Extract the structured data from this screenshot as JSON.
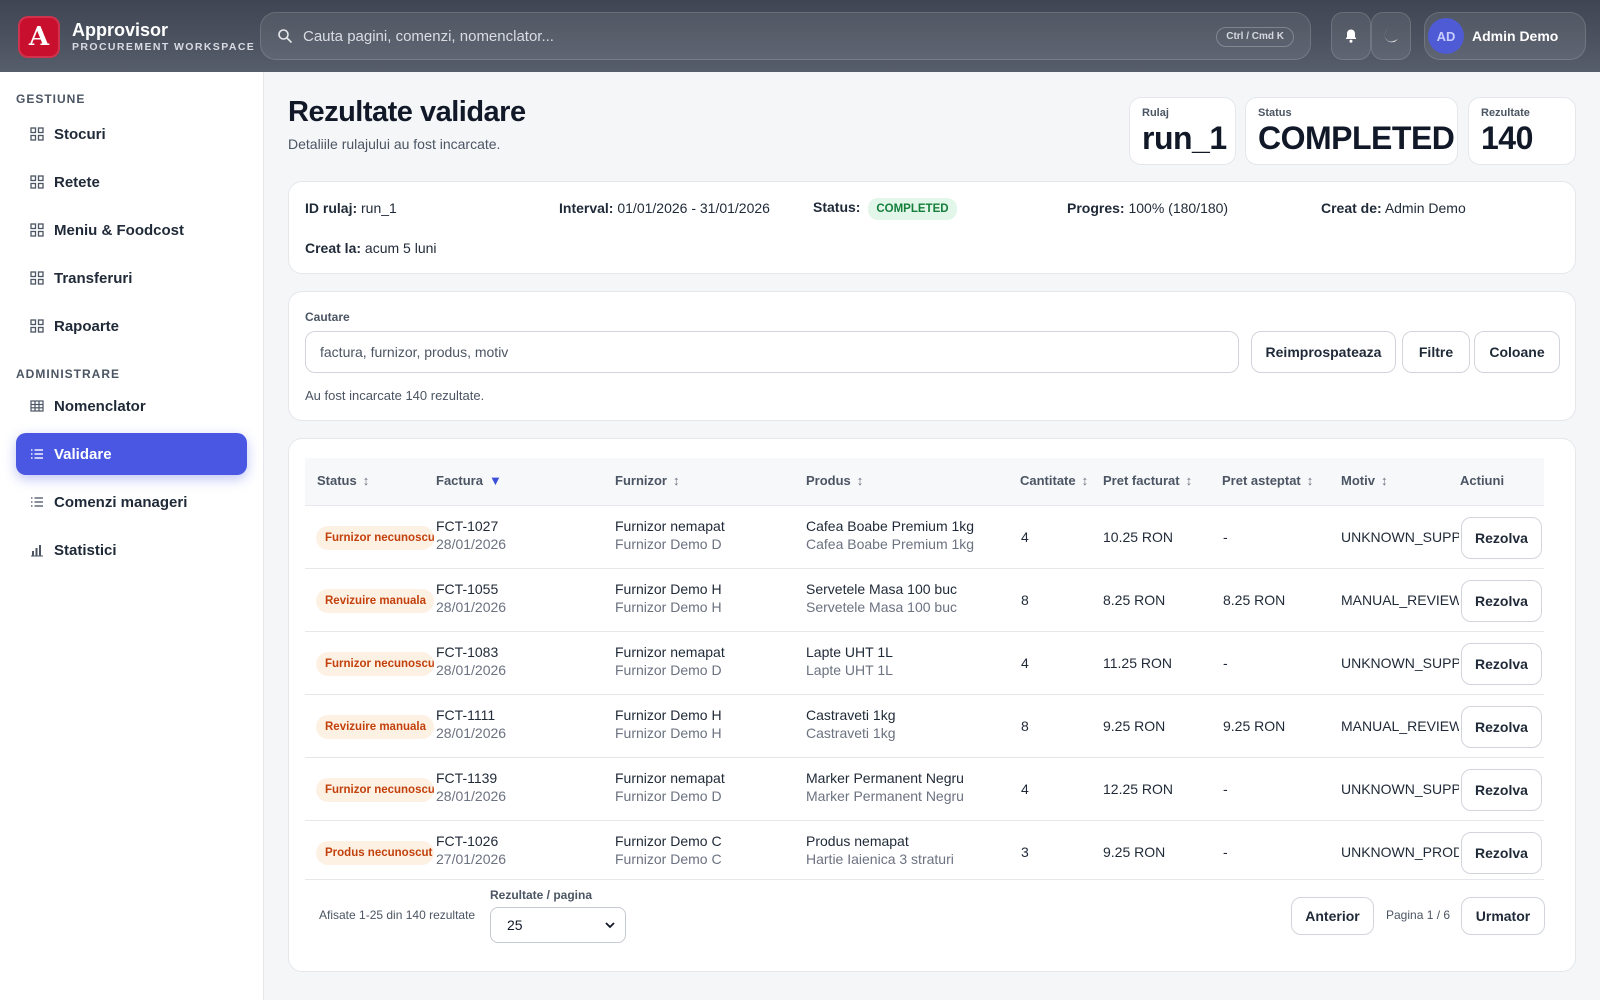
{
  "app": {
    "logo_letter": "A",
    "name": "Approvisor",
    "subtitle": "PROCUREMENT WORKSPACE",
    "search_placeholder": "Cauta pagini, comenzi, nomenclator...",
    "search_shortcut": "Ctrl / Cmd K",
    "user_initials": "AD",
    "user_name": "Admin Demo",
    "icons": {
      "search": "search-icon",
      "notifications": "bell-icon",
      "theme": "moon-icon"
    }
  },
  "sidebar": {
    "section_gestiune": "GESTIUNE",
    "gestiune": [
      {
        "label": "Stocuri",
        "icon": "grid-icon"
      },
      {
        "label": "Retete",
        "icon": "grid-icon"
      },
      {
        "label": "Meniu & Foodcost",
        "icon": "grid-icon"
      },
      {
        "label": "Transferuri",
        "icon": "grid-icon"
      },
      {
        "label": "Rapoarte",
        "icon": "grid-icon"
      }
    ],
    "section_administrare": "ADMINISTRARE",
    "administrare": [
      {
        "label": "Nomenclator",
        "icon": "table-icon"
      },
      {
        "label": "Validare",
        "icon": "list-icon",
        "active": true
      },
      {
        "label": "Comenzi manageri",
        "icon": "list-icon"
      },
      {
        "label": "Statistici",
        "icon": "bar-chart-icon"
      }
    ]
  },
  "header": {
    "title": "Rezultate validare",
    "subtitle": "Detaliile rulajului au fost incarcate.",
    "stats": [
      {
        "label": "Rulaj",
        "value": "run_1"
      },
      {
        "label": "Status",
        "value": "COMPLETED"
      },
      {
        "label": "Rezultate",
        "value": "140"
      }
    ]
  },
  "info": {
    "id_label": "ID rulaj:",
    "id_value": "run_1",
    "interval_label": "Interval:",
    "interval_value": "01/01/2026 - 31/01/2026",
    "status_label": "Status:",
    "status_value": "COMPLETED",
    "progress_label": "Progres:",
    "progress_value": "100% (180/180)",
    "created_by_label": "Creat de:",
    "created_by_value": "Admin Demo",
    "created_at_label": "Creat la:",
    "created_at_value": "acum 5 luni"
  },
  "filters": {
    "search_label": "Cautare",
    "search_placeholder": "factura, furnizor, produs, motiv",
    "refresh": "Reimprospateaza",
    "filters": "Filtre",
    "columns": "Coloane",
    "loaded_text": "Au fost incarcate 140 rezultate."
  },
  "table": {
    "sort_icon": "↕",
    "sort_active_icon": "▼",
    "columns": [
      "Status",
      "Factura",
      "Furnizor",
      "Produs",
      "Cantitate",
      "Pret facturat",
      "Pret asteptat",
      "Motiv",
      "Actiuni"
    ],
    "action_label": "Rezolva",
    "rows": [
      {
        "status": "Furnizor necunoscut",
        "invoice": "FCT-1027",
        "date": "28/01/2026",
        "supplier": "Furnizor nemapat",
        "supplier_sub": "Furnizor Demo D",
        "product": "Cafea Boabe Premium 1kg",
        "product_sub": "Cafea Boabe Premium 1kg",
        "qty": "4",
        "invoiced": "10.25 RON",
        "expected": "-",
        "reason": "UNKNOWN_SUPPLIER"
      },
      {
        "status": "Revizuire manuala",
        "invoice": "FCT-1055",
        "date": "28/01/2026",
        "supplier": "Furnizor Demo H",
        "supplier_sub": "Furnizor Demo H",
        "product": "Servetele Masa 100 buc",
        "product_sub": "Servetele Masa 100 buc",
        "qty": "8",
        "invoiced": "8.25 RON",
        "expected": "8.25 RON",
        "reason": "MANUAL_REVIEW"
      },
      {
        "status": "Furnizor necunoscut",
        "invoice": "FCT-1083",
        "date": "28/01/2026",
        "supplier": "Furnizor nemapat",
        "supplier_sub": "Furnizor Demo D",
        "product": "Lapte UHT 1L",
        "product_sub": "Lapte UHT 1L",
        "qty": "4",
        "invoiced": "11.25 RON",
        "expected": "-",
        "reason": "UNKNOWN_SUPPLIER"
      },
      {
        "status": "Revizuire manuala",
        "invoice": "FCT-1111",
        "date": "28/01/2026",
        "supplier": "Furnizor Demo H",
        "supplier_sub": "Furnizor Demo H",
        "product": "Castraveti 1kg",
        "product_sub": "Castraveti 1kg",
        "qty": "8",
        "invoiced": "9.25 RON",
        "expected": "9.25 RON",
        "reason": "MANUAL_REVIEW"
      },
      {
        "status": "Furnizor necunoscut",
        "invoice": "FCT-1139",
        "date": "28/01/2026",
        "supplier": "Furnizor nemapat",
        "supplier_sub": "Furnizor Demo D",
        "product": "Marker Permanent Negru",
        "product_sub": "Marker Permanent Negru",
        "qty": "4",
        "invoiced": "12.25 RON",
        "expected": "-",
        "reason": "UNKNOWN_SUPPLIER"
      },
      {
        "status": "Produs necunoscut",
        "invoice": "FCT-1026",
        "date": "27/01/2026",
        "supplier": "Furnizor Demo C",
        "supplier_sub": "Furnizor Demo C",
        "product": "Produs nemapat",
        "product_sub": "Hartie Iaienica 3 straturi",
        "qty": "3",
        "invoiced": "9.25 RON",
        "expected": "-",
        "reason": "UNKNOWN_PRODUCT"
      }
    ]
  },
  "pager": {
    "showing": "Afisate 1-25 din 140 rezultate",
    "per_page_label": "Rezultate / pagina",
    "per_page_value": "25",
    "prev": "Anterior",
    "page": "Pagina 1 / 6",
    "next": "Urmator"
  },
  "colors": {
    "accent": "#4957e3",
    "brand": "#c8102e",
    "warning_bg": "#fdf1e4",
    "warning_text": "#c2410c",
    "success_bg": "#e3f6ea",
    "success_text": "#157f3b"
  }
}
